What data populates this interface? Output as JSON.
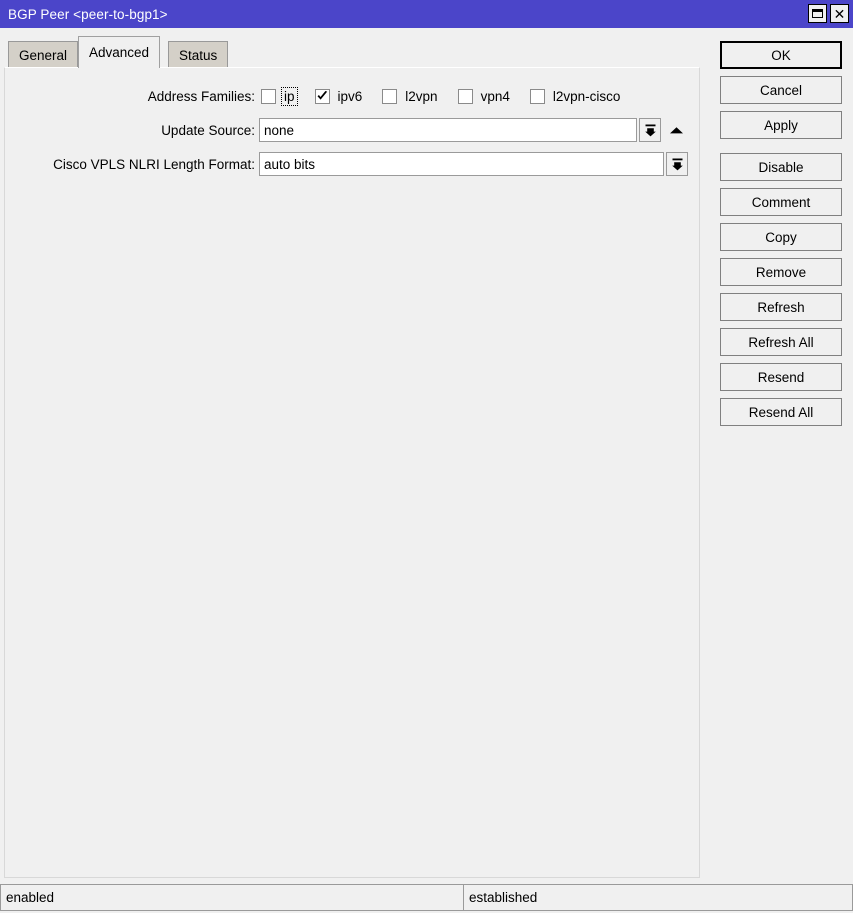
{
  "window": {
    "title": "BGP Peer <peer-to-bgp1>",
    "controls": [
      {
        "name": "maximize-button",
        "label": ""
      },
      {
        "name": "close-button",
        "label": "✕"
      }
    ]
  },
  "tabs": [
    {
      "label": "General",
      "active": false
    },
    {
      "label": "Advanced",
      "active": true
    },
    {
      "label": "Status",
      "active": false
    }
  ],
  "form": {
    "address_families": {
      "label": "Address Families:",
      "options": [
        {
          "label": "ip",
          "checked": false,
          "focused": true
        },
        {
          "label": "ipv6",
          "checked": true,
          "focused": false
        },
        {
          "label": "l2vpn",
          "checked": false,
          "focused": false
        },
        {
          "label": "vpn4",
          "checked": false,
          "focused": false
        },
        {
          "label": "l2vpn-cisco",
          "checked": false,
          "focused": false
        }
      ]
    },
    "update_source": {
      "label": "Update Source:",
      "value": "none",
      "placeholder": ""
    },
    "cisco_vpls_nlri": {
      "label": "Cisco VPLS NLRI Length Format:",
      "value": "auto bits",
      "placeholder": ""
    }
  },
  "buttons": [
    {
      "label": "OK",
      "default": true,
      "spaced": false
    },
    {
      "label": "Cancel",
      "default": false,
      "spaced": false
    },
    {
      "label": "Apply",
      "default": false,
      "spaced": false
    },
    {
      "label": "Disable",
      "default": false,
      "spaced": true
    },
    {
      "label": "Comment",
      "default": false,
      "spaced": false
    },
    {
      "label": "Copy",
      "default": false,
      "spaced": false
    },
    {
      "label": "Remove",
      "default": false,
      "spaced": false
    },
    {
      "label": "Refresh",
      "default": false,
      "spaced": false
    },
    {
      "label": "Refresh All",
      "default": false,
      "spaced": false
    },
    {
      "label": "Resend",
      "default": false,
      "spaced": false
    },
    {
      "label": "Resend All",
      "default": false,
      "spaced": false
    }
  ],
  "statusbar": {
    "left": "enabled",
    "right": "established"
  },
  "colors": {
    "titlebar": "#4b45c9",
    "titlebar_text": "#ffffff",
    "window_bg": "#f0f0f0",
    "tab_inactive": "#d4d0c8",
    "input_bg": "#ffffff"
  }
}
